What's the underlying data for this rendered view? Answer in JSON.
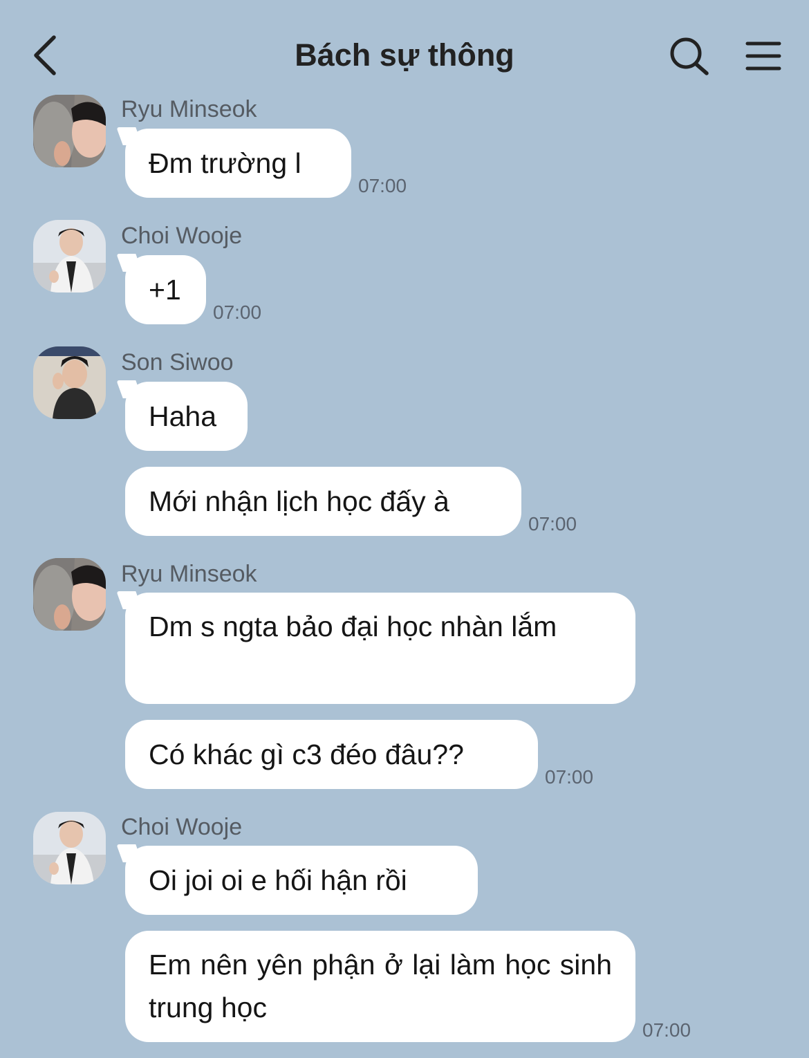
{
  "header": {
    "title": "Bách sự thông"
  },
  "messages": [
    {
      "sender": "Ryu Minseok",
      "texts": [
        "Đm trường l"
      ],
      "time": "07:00"
    },
    {
      "sender": "Choi Wooje",
      "texts": [
        "+1"
      ],
      "time": "07:00"
    },
    {
      "sender": "Son Siwoo",
      "texts": [
        "Haha",
        "Mới nhận lịch học đấy à"
      ],
      "time": "07:00"
    },
    {
      "sender": "Ryu Minseok",
      "texts": [
        "Dm s ngta bảo đại học nhàn lắm",
        "Có khác gì c3 đéo đâu??"
      ],
      "time": "07:00"
    },
    {
      "sender": "Choi Wooje",
      "texts": [
        "Oi joi oi e hối hận rồi",
        "Em nên yên phận ở lại làm học sinh trung học"
      ],
      "time": "07:00"
    }
  ],
  "icons": {
    "back": "chevron-left-icon",
    "search": "search-icon",
    "menu": "menu-icon"
  },
  "colors": {
    "background": "#abc1d4",
    "bubble": "#ffffff"
  }
}
